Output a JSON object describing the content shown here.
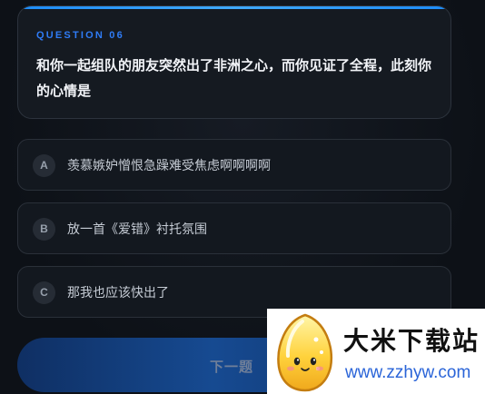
{
  "question": {
    "number_label": "QUESTION 06",
    "text": "和你一起组队的朋友突然出了非洲之心，而你见证了全程，此刻你的心情是"
  },
  "options": [
    {
      "letter": "A",
      "label": "羡慕嫉妒憎恨急躁难受焦虑啊啊啊啊"
    },
    {
      "letter": "B",
      "label": "放一首《爱错》衬托氛围"
    },
    {
      "letter": "C",
      "label": "那我也应该快出了"
    }
  ],
  "next_button": {
    "label": "下一题"
  },
  "watermark": {
    "brand": "大米下载站",
    "url": "www.zzhyw.com"
  },
  "colors": {
    "accent": "#2f7cf6",
    "background": "#0d1117",
    "card": "#151a21",
    "button": "#164a91"
  },
  "icons": {
    "mascot": "rice-grain-mascot-icon"
  }
}
